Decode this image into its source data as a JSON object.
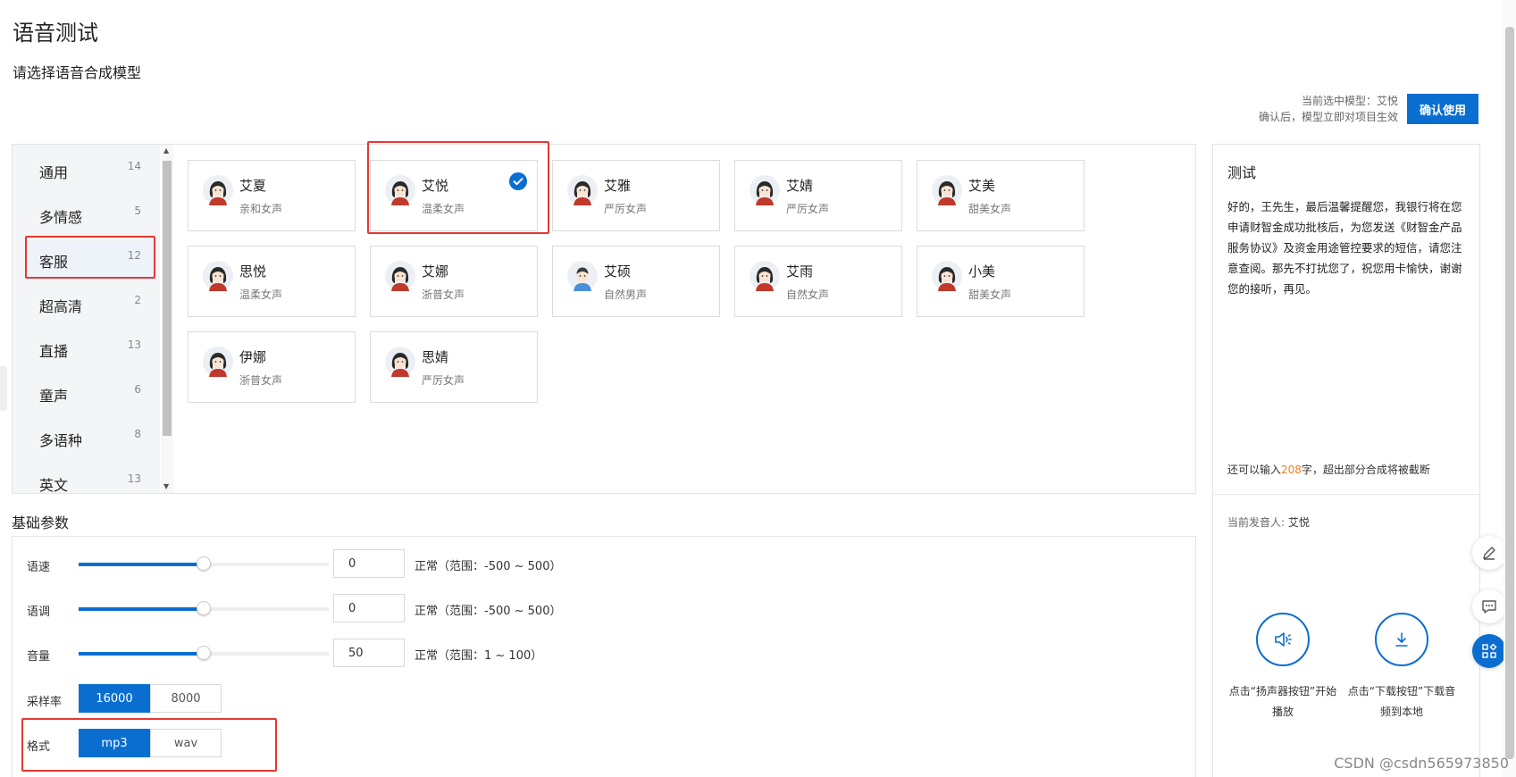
{
  "page": {
    "title": "语音测试",
    "subtitle": "请选择语音合成模型"
  },
  "top_bar": {
    "current_model": "当前选中模型：艾悦",
    "confirm_hint": "确认后，模型立即对项目生效",
    "confirm_button": "确认使用"
  },
  "categories": [
    {
      "name": "通用",
      "count": "14"
    },
    {
      "name": "多情感",
      "count": "5"
    },
    {
      "name": "客服",
      "count": "12"
    },
    {
      "name": "超高清",
      "count": "2"
    },
    {
      "name": "直播",
      "count": "13"
    },
    {
      "name": "童声",
      "count": "6"
    },
    {
      "name": "多语种",
      "count": "8"
    },
    {
      "name": "英文",
      "count": "13"
    }
  ],
  "voices": [
    {
      "name": "艾夏",
      "desc": "亲和女声",
      "gender": "female"
    },
    {
      "name": "艾悦",
      "desc": "温柔女声",
      "gender": "female",
      "selected": true
    },
    {
      "name": "艾雅",
      "desc": "严厉女声",
      "gender": "female"
    },
    {
      "name": "艾婧",
      "desc": "严厉女声",
      "gender": "female"
    },
    {
      "name": "艾美",
      "desc": "甜美女声",
      "gender": "female"
    },
    {
      "name": "思悦",
      "desc": "温柔女声",
      "gender": "female"
    },
    {
      "name": "艾娜",
      "desc": "浙普女声",
      "gender": "female"
    },
    {
      "name": "艾硕",
      "desc": "自然男声",
      "gender": "male"
    },
    {
      "name": "艾雨",
      "desc": "自然女声",
      "gender": "female"
    },
    {
      "name": "小美",
      "desc": "甜美女声",
      "gender": "female"
    },
    {
      "name": "伊娜",
      "desc": "浙普女声",
      "gender": "female"
    },
    {
      "name": "思婧",
      "desc": "严厉女声",
      "gender": "female"
    }
  ],
  "params": {
    "title": "基础参数",
    "speed": {
      "label": "语速",
      "value": "0",
      "range": "正常（范围：-500 ~ 500）",
      "level": 0.5
    },
    "pitch": {
      "label": "语调",
      "value": "0",
      "range": "正常（范围：-500 ~ 500）",
      "level": 0.5
    },
    "volume": {
      "label": "音量",
      "value": "50",
      "range": "正常（范围：1 ~ 100）",
      "level": 0.5
    },
    "sample_rate": {
      "label": "采样率",
      "options": [
        "16000",
        "8000"
      ],
      "selected": "16000"
    },
    "format": {
      "label": "格式",
      "options": [
        "mp3",
        "wav"
      ],
      "selected": "mp3"
    }
  },
  "test": {
    "title": "测试",
    "text": "好的，王先生，最后温馨提醒您，我银行将在您申请财智金成功批核后，为您发送《财智金产品服务协议》及资金用途管控要求的短信，请您注意查阅。那先不打扰您了，祝您用卡愉快，谢谢您的接听，再见。",
    "remain_prefix": "还可以输入",
    "remain_count": "208",
    "remain_suffix": "字，超出部分合成将被截断",
    "speaker_label": "当前发音人: ",
    "speaker_name": "艾悦",
    "play_caption": "点击“扬声器按钮”开始播放",
    "download_caption": "点击“下载按钮”下载音频到本地"
  },
  "watermark": "CSDN @csdn565973850",
  "colors": {
    "accent": "#0a6ed1",
    "highlight": "#e53935",
    "remain": "#f07c22"
  }
}
